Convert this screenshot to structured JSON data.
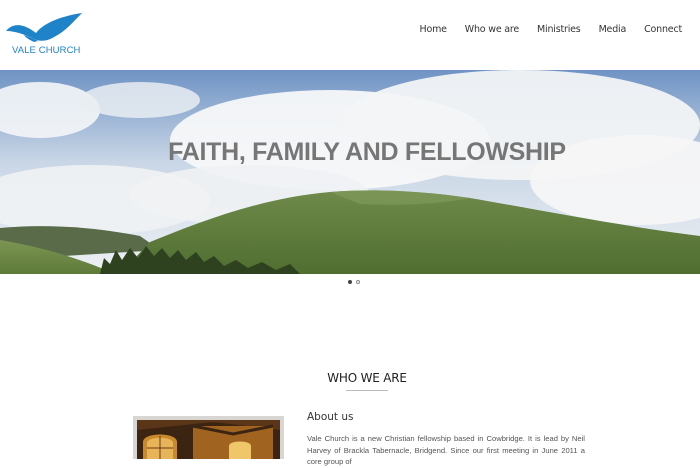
{
  "header": {
    "logo_text": "VALE CHURCH",
    "nav": [
      "Home",
      "Who we are",
      "Ministries",
      "Media",
      "Connect"
    ]
  },
  "hero": {
    "title": "FAITH, FAMILY AND FELLOWSHIP",
    "slide_indicators": {
      "count": 2,
      "active_index": 0
    }
  },
  "who_we_are": {
    "title": "WHO WE ARE",
    "about_heading": "About us",
    "about_text": "Vale Church is a new Christian fellowship based in Cowbridge. It is lead by Neil Harvey of Brackla Tabernacle, Bridgend. Since our first meeting in June 2011 a core group of"
  },
  "colors": {
    "brand_blue": "#1f83c9",
    "hero_title": "#767676"
  },
  "icons": {
    "logo": "bird-wings-logo-icon"
  }
}
